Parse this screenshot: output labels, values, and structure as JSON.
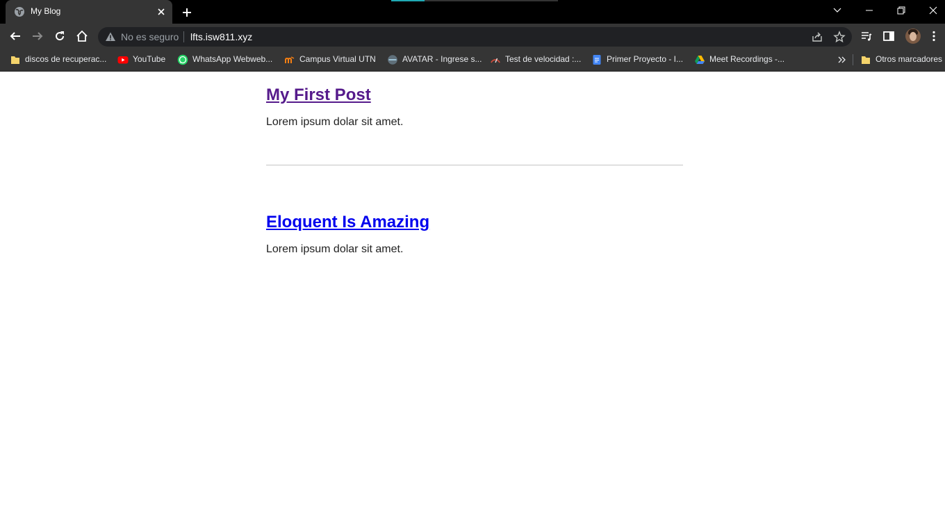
{
  "browser": {
    "tab": {
      "title": "My Blog"
    },
    "window_controls": [
      "tab-search",
      "minimize",
      "restore",
      "close"
    ],
    "omnibox": {
      "security_label": "No es seguro",
      "url": "lfts.isw811.xyz"
    },
    "bookmarks": [
      {
        "label": "discos de recuperac...",
        "icon": "folder-icon"
      },
      {
        "label": "YouTube",
        "icon": "youtube-icon"
      },
      {
        "label": "WhatsApp Webweb...",
        "icon": "whatsapp-icon"
      },
      {
        "label": "Campus Virtual UTN",
        "icon": "moodle-icon"
      },
      {
        "label": "AVATAR - Ingrese s...",
        "icon": "avatar-site-icon"
      },
      {
        "label": "Test de velocidad :...",
        "icon": "speedtest-icon"
      },
      {
        "label": "Primer Proyecto - I...",
        "icon": "google-docs-icon"
      },
      {
        "label": "Meet Recordings -...",
        "icon": "google-drive-icon"
      }
    ],
    "other_bookmarks_label": "Otros marcadores",
    "colors": {
      "chrome_dark": "#353535",
      "tabstrip": "#000000",
      "omnibox": "#202124"
    }
  },
  "page": {
    "posts": [
      {
        "title": "My First Post",
        "body": "Lorem ipsum dolar sit amet.",
        "link_state": "visited"
      },
      {
        "title": "Eloquent Is Amazing",
        "body": "Lorem ipsum dolar sit amet.",
        "link_state": "unvisited"
      }
    ],
    "colors": {
      "visited_link": "#551a8b",
      "link": "#0000ee",
      "text": "#222222"
    }
  }
}
